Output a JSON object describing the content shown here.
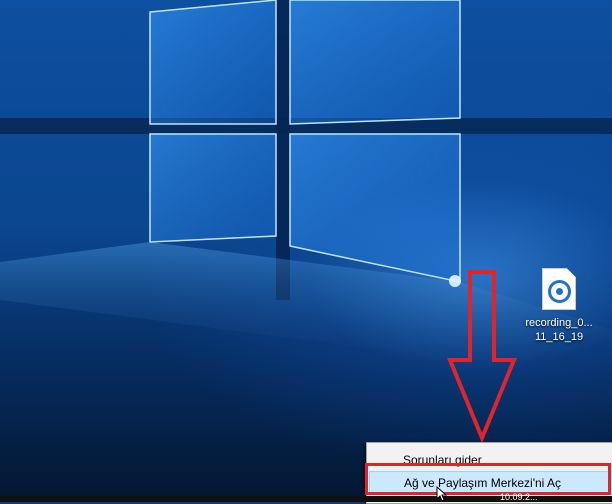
{
  "desktop": {
    "icons": [
      {
        "label": "recording_0...\n11_16_19",
        "icon": "audio-file-icon"
      }
    ]
  },
  "context_menu": {
    "items": [
      {
        "label": "Sorunları gider"
      },
      {
        "label": "Ağ ve Paylaşım Merkezi'ni Aç"
      }
    ]
  },
  "taskbar": {
    "clock_text": "10.09.2..."
  },
  "colors": {
    "annotation_red": "#e0242c",
    "menu_highlight": "#cce8ff",
    "desktop_blue": "#0b468f"
  }
}
